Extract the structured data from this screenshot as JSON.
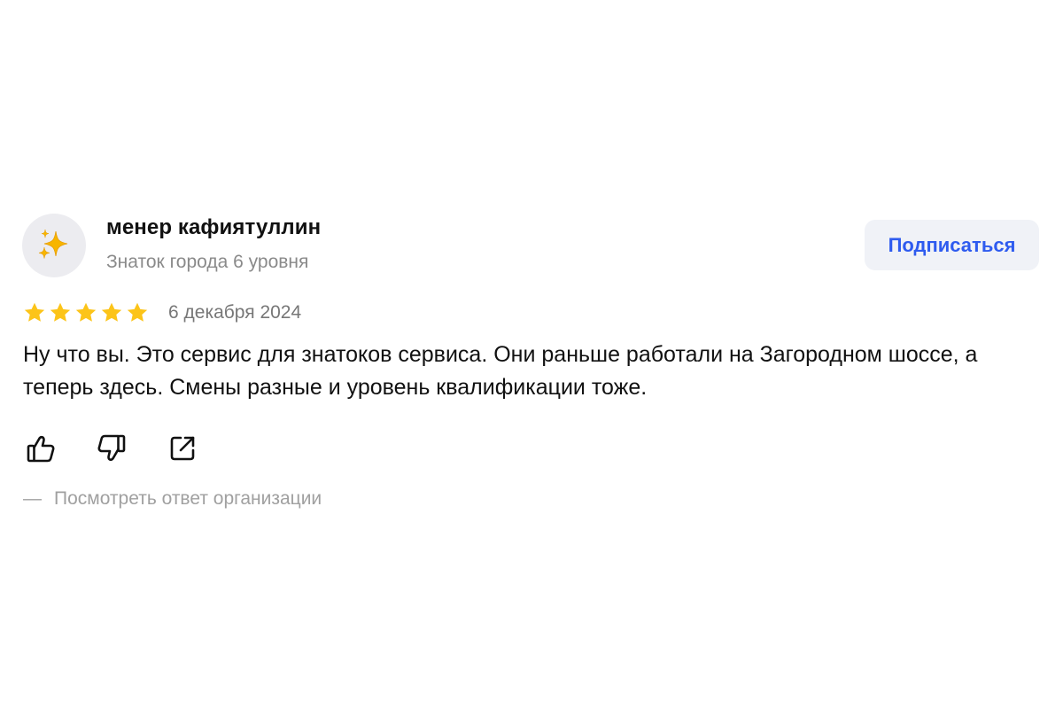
{
  "author": {
    "name": "менер кафиятуллин",
    "level": "Знаток города 6 уровня",
    "avatar_icon": "sparkles-icon"
  },
  "subscribe": {
    "label": "Подписаться"
  },
  "review": {
    "rating": 5,
    "max_rating": 5,
    "date": "6 декабря 2024",
    "text": "Ну что вы. Это сервис для знатоков сервиса. Они раньше работали на Загородном шоссе, а теперь здесь. Смены разные и уровень квалификации тоже."
  },
  "actions": [
    {
      "icon": "thumbs-up-icon"
    },
    {
      "icon": "thumbs-down-icon"
    },
    {
      "icon": "share-icon"
    }
  ],
  "org_reply": {
    "dash": "—",
    "label": "Посмотреть ответ организации"
  },
  "colors": {
    "accent": "#2e5bef",
    "star": "#fcc419",
    "button_bg": "#f0f2f7",
    "muted_text": "#8a8a8a"
  }
}
